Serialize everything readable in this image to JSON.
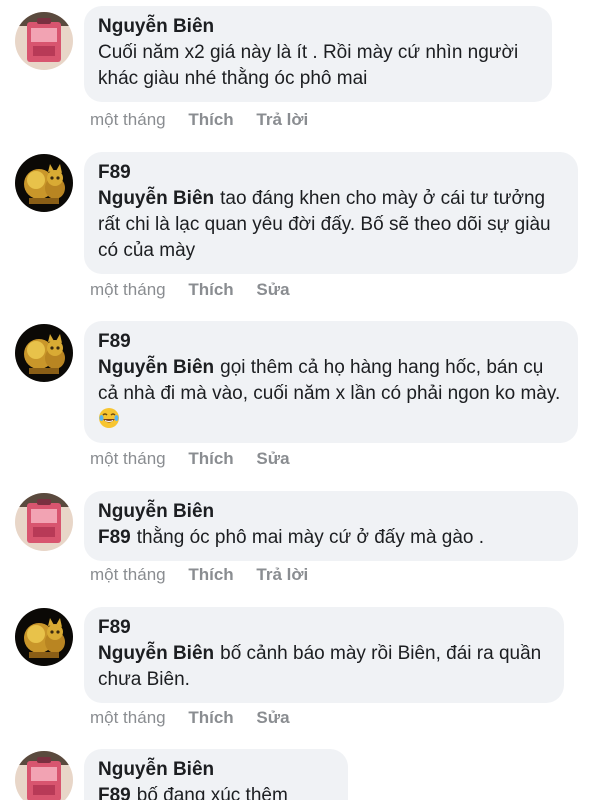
{
  "comments": [
    {
      "author": "Nguyễn Biên",
      "avatar": "pink-bag-photo",
      "mention": "",
      "text": "Cuối năm x2 giá này là ít . Rồi mày cứ nhìn người khác giàu nhé thằng óc phô mai",
      "time": "một tháng",
      "like_label": "Thích",
      "action_label": "Trả lời"
    },
    {
      "author": "F89",
      "avatar": "golden-muscle-cat",
      "mention": "Nguyễn Biên",
      "text": "tao đáng khen cho mày ở cái tư tưởng rất chi là lạc quan yêu đời đấy. Bố sẽ theo dõi sự giàu có của mày",
      "time": "một tháng",
      "like_label": "Thích",
      "action_label": "Sửa"
    },
    {
      "author": "F89",
      "avatar": "golden-muscle-cat",
      "mention": "Nguyễn Biên",
      "text": "gọi thêm cả họ hàng hang hốc, bán cụ cả nhà đi mà vào, cuối năm x lần có phải ngon ko mày.",
      "emoji": "laughing-tears-emoji",
      "time": "một tháng",
      "like_label": "Thích",
      "action_label": "Sửa"
    },
    {
      "author": "Nguyễn Biên",
      "avatar": "pink-bag-photo",
      "mention": "F89",
      "text": "thằng óc phô mai mày cứ ở đấy mà gào .",
      "time": "một tháng",
      "like_label": "Thích",
      "action_label": "Trả lời"
    },
    {
      "author": "F89",
      "avatar": "golden-muscle-cat",
      "mention": "Nguyễn Biên",
      "text": "bố cảnh báo mày rồi Biên, đái ra quần chưa Biên.",
      "time": "một tháng",
      "like_label": "Thích",
      "action_label": "Sửa"
    },
    {
      "author": "Nguyễn Biên",
      "avatar": "pink-bag-photo",
      "mention": "F89",
      "text": "bố đang xúc thêm"
    }
  ],
  "colors": {
    "bubble": "#f0f2f5",
    "meta": "#8a8d91",
    "text": "#1c1e21"
  }
}
